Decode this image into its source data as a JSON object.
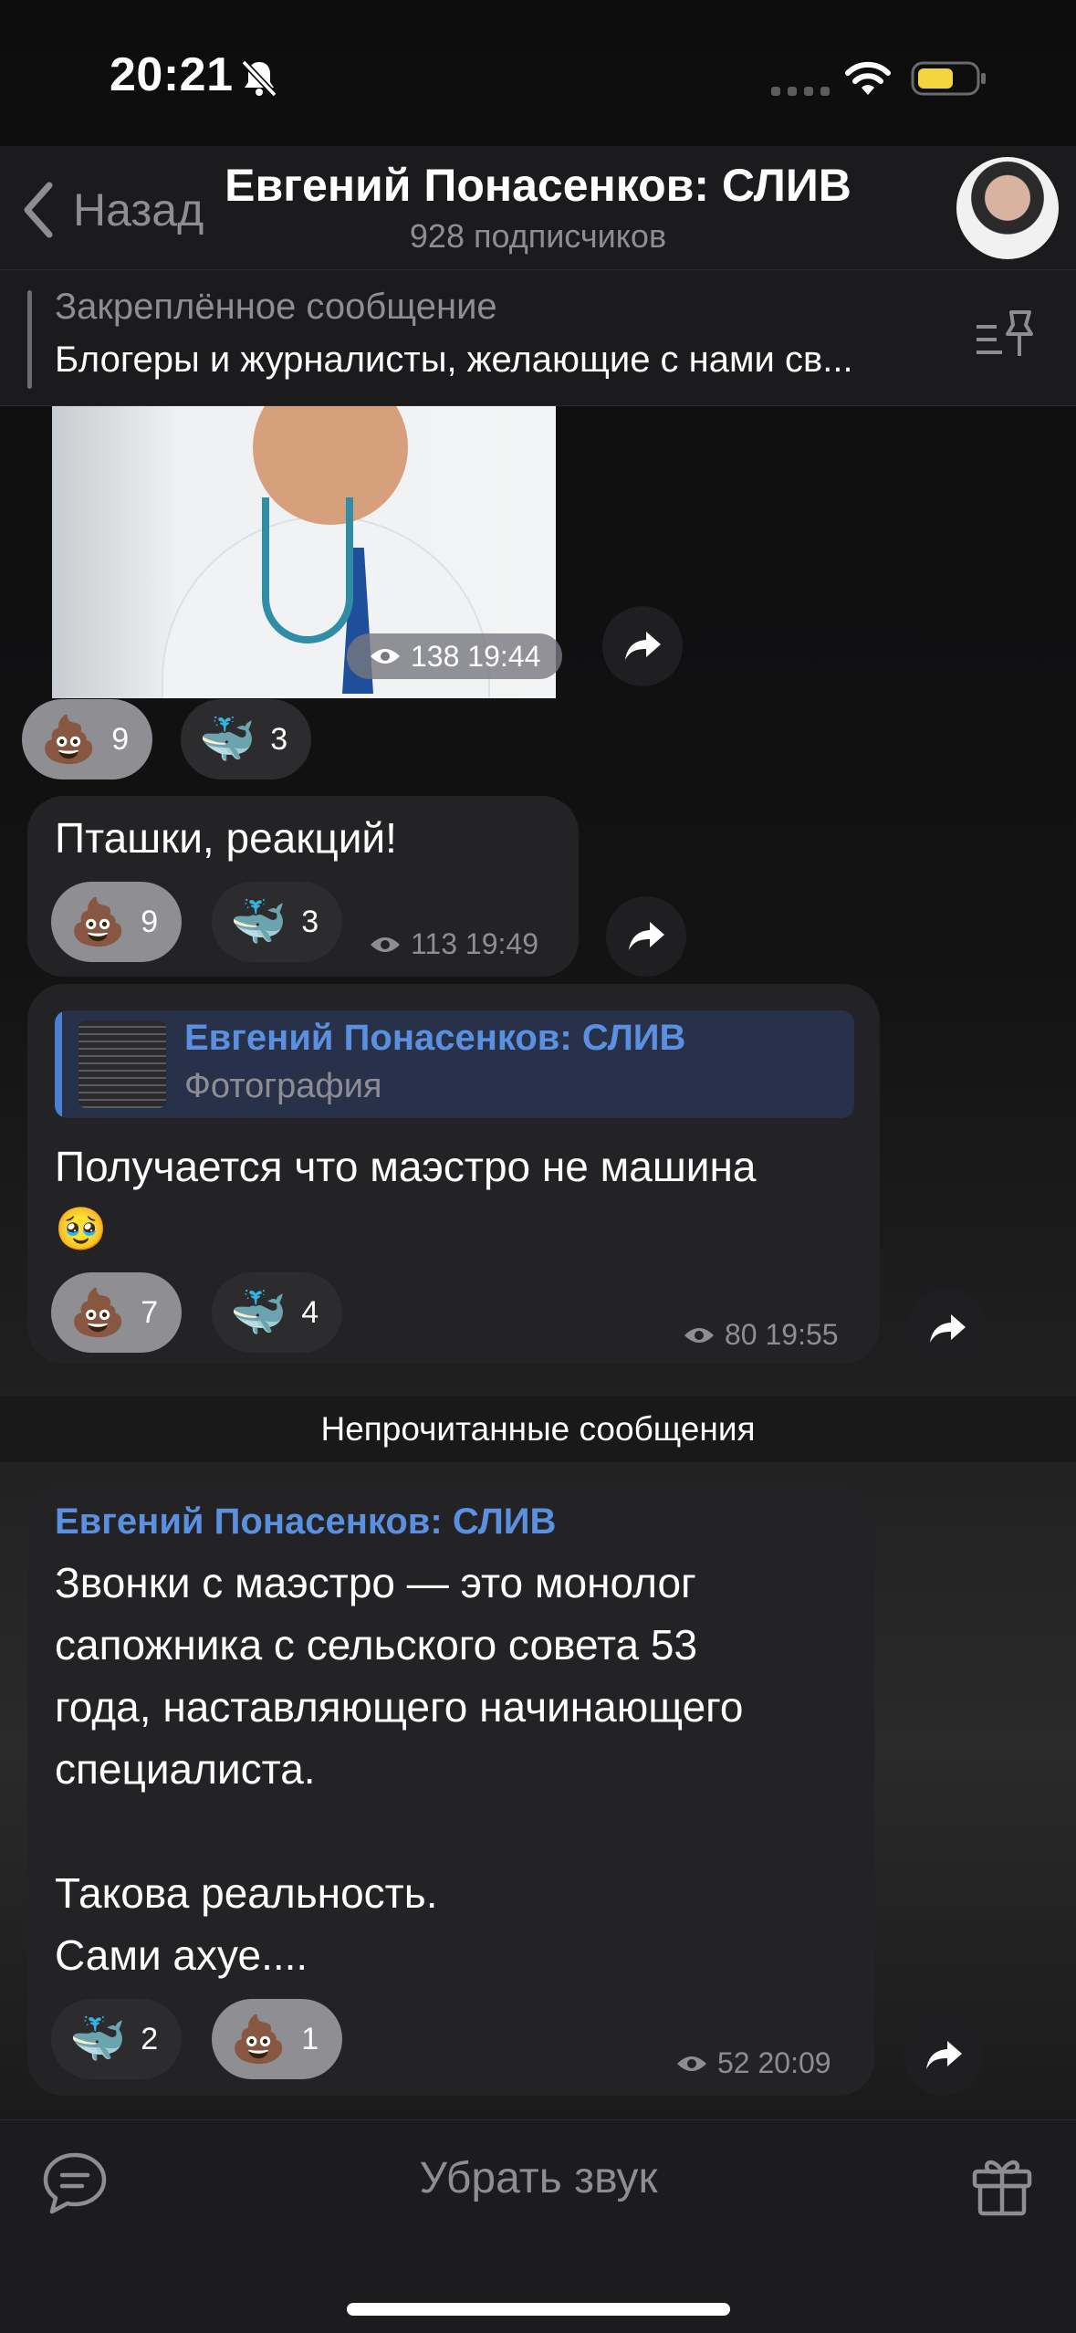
{
  "status_bar": {
    "time": "20:21"
  },
  "header": {
    "back_label": "Назад",
    "title": "Евгений Понасенков: СЛИВ",
    "subscribers": "928 подписчиков"
  },
  "pinned": {
    "label": "Закреплённое сообщение",
    "text": "Блогеры и журналисты, желающие с нами св..."
  },
  "messages": [
    {
      "type": "photo",
      "views": "138",
      "time": "19:44",
      "reactions": [
        {
          "emoji": "💩",
          "count": "9",
          "chosen": true
        },
        {
          "emoji": "🐳",
          "count": "3",
          "chosen": false
        }
      ]
    },
    {
      "type": "text",
      "text": "Пташки, реакций!",
      "views": "113",
      "time": "19:49",
      "reactions": [
        {
          "emoji": "💩",
          "count": "9",
          "chosen": true
        },
        {
          "emoji": "🐳",
          "count": "3",
          "chosen": false
        }
      ]
    },
    {
      "type": "reply",
      "reply_title": "Евгений Понасенков: СЛИВ",
      "reply_subtitle": "Фотография",
      "text_line1": "Получается что маэстро не машина",
      "text_line2": "🥹",
      "views": "80",
      "time": "19:55",
      "reactions": [
        {
          "emoji": "💩",
          "count": "7",
          "chosen": true
        },
        {
          "emoji": "🐳",
          "count": "4",
          "chosen": false
        }
      ]
    },
    {
      "type": "text",
      "sender": "Евгений Понасенков: СЛИВ",
      "lines": [
        "Звонки с маэстро — это монолог",
        "сапожника с сельского совета 53",
        "года, наставляющего начинающего",
        "специалиста.",
        "",
        "Такова реальность.",
        "Сами ахуе...."
      ],
      "views": "52",
      "time": "20:09",
      "reactions": [
        {
          "emoji": "🐳",
          "count": "2",
          "chosen": false
        },
        {
          "emoji": "💩",
          "count": "1",
          "chosen": true
        }
      ]
    }
  ],
  "unread_divider": "Непрочитанные сообщения",
  "bottom_bar": {
    "mute_label": "Убрать звук"
  },
  "icons": {
    "bell": "bell-slash-icon",
    "signal": "cellular-signal-icon",
    "wifi": "wifi-icon",
    "battery": "battery-icon",
    "back": "chevron-left-icon",
    "pin_list": "pin-list-icon",
    "views": "eye-icon",
    "share": "share-arrow-icon",
    "discuss": "chat-bubble-icon",
    "gift": "gift-icon"
  },
  "colors": {
    "accent_blue": "#5b8fe0",
    "battery_yellow": "#f5d442",
    "bubble": "#232325",
    "chosen_reaction": "#8e8e93"
  }
}
